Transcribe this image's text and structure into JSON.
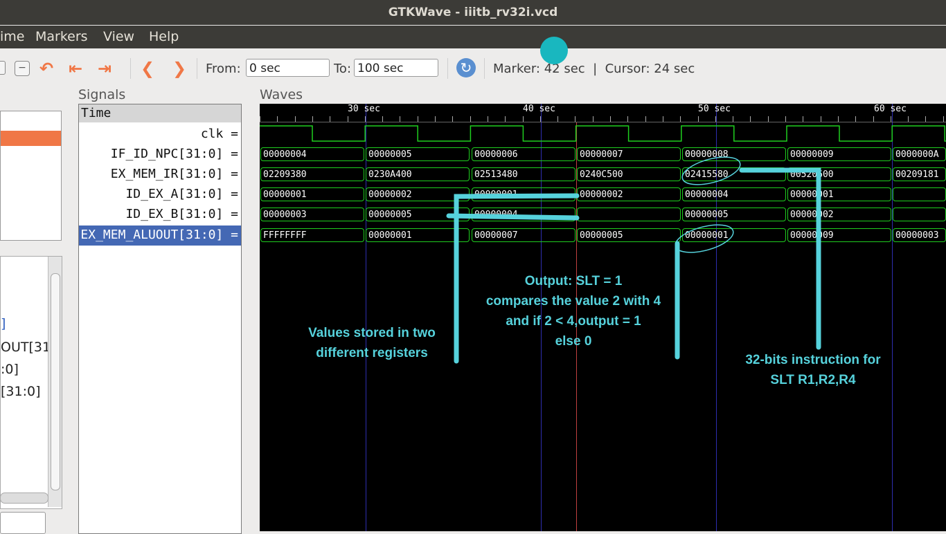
{
  "window": {
    "title": "GTKWave - iiitb_rv32i.vcd"
  },
  "menu": [
    "ime",
    "Markers",
    "View",
    "Help"
  ],
  "toolbar": {
    "from_label": "From:",
    "from_value": "0 sec",
    "to_label": "To:",
    "to_value": "100 sec",
    "status": "Marker: 42 sec  |  Cursor: 24 sec"
  },
  "left_panel": {
    "tree_items": [
      "]",
      "OUT[31:",
      ":0]",
      "[31:0]"
    ]
  },
  "signals": {
    "header": "Signals",
    "time_label": "Time",
    "rows": [
      "clk =",
      "IF_ID_NPC[31:0] =",
      "EX_MEM_IR[31:0] =",
      "ID_EX_A[31:0] =",
      "ID_EX_B[31:0] =",
      "EX_MEM_ALUOUT[31:0] ="
    ]
  },
  "waves": {
    "header": "Waves",
    "ticks": [
      "30 sec",
      "40 sec",
      "50 sec",
      "60 sec"
    ],
    "rows": {
      "if_id_npc": [
        "00000004",
        "00000005",
        "00000006",
        "00000007",
        "00000008",
        "00000009",
        "0000000A"
      ],
      "ex_mem_ir": [
        "02209380",
        "0230A400",
        "02513480",
        "0240C500",
        "02415580",
        "00520600",
        "00209181"
      ],
      "id_ex_a": [
        "00000001",
        "00000002",
        "00000001",
        "00000002",
        "00000004",
        "00000001",
        ""
      ],
      "id_ex_b": [
        "00000003",
        "00000005",
        "00000004",
        "",
        "00000005",
        "00000002",
        ""
      ],
      "ex_mem_aluout": [
        "FFFFFFFF",
        "00000001",
        "00000007",
        "00000005",
        "00000001",
        "00000009",
        "00000003"
      ]
    }
  },
  "annotations": {
    "registers": [
      "Values stored in two",
      "different registers"
    ],
    "output": [
      "Output: SLT = 1",
      "compares the value 2 with 4",
      "and if 2 < 4,output = 1",
      "else 0"
    ],
    "instruction": [
      "32-bits instruction for",
      "SLT R1,R2,R4"
    ]
  },
  "colors": {
    "wave": "#1fcf1f",
    "annotation": "#56d2dc",
    "marker": "#c04040",
    "selected_row": "#4468b4"
  }
}
